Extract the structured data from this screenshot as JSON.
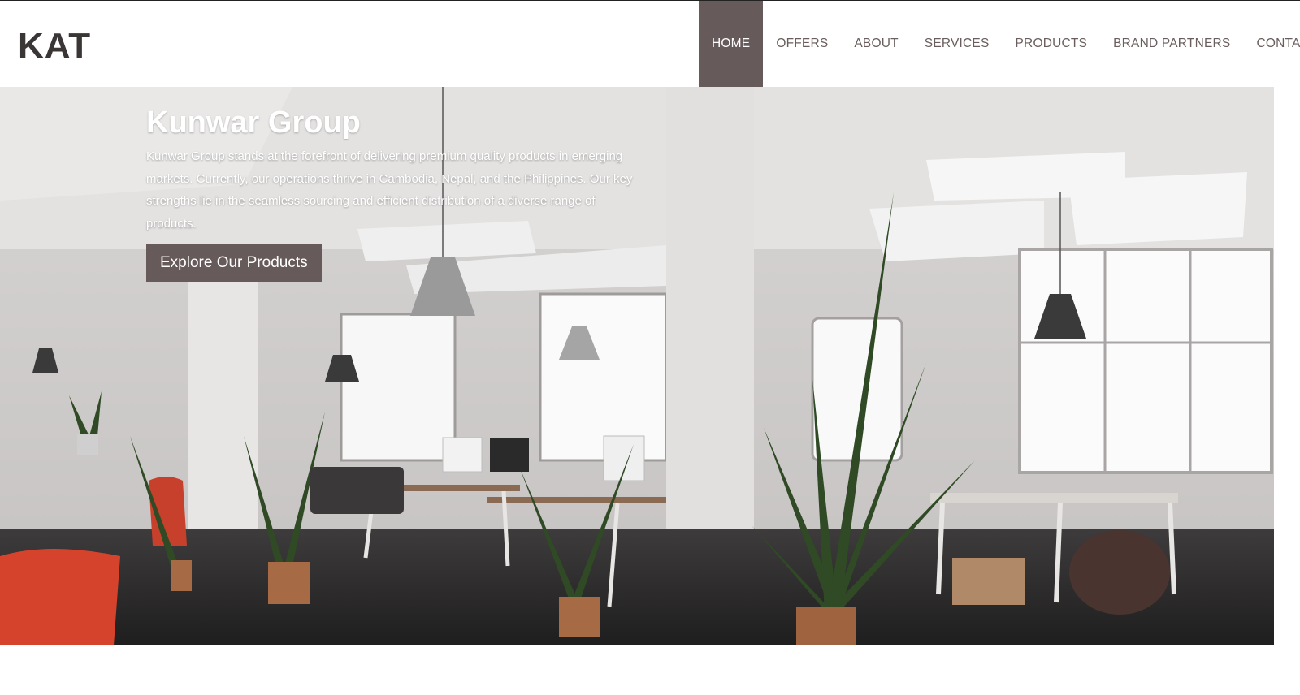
{
  "brand": {
    "logo": "KAT"
  },
  "nav": {
    "items": [
      {
        "label": "HOME",
        "active": true
      },
      {
        "label": "OFFERS",
        "active": false
      },
      {
        "label": "ABOUT",
        "active": false
      },
      {
        "label": "SERVICES",
        "active": false
      },
      {
        "label": "PRODUCTS",
        "active": false
      },
      {
        "label": "BRAND PARTNERS",
        "active": false
      },
      {
        "label": "CONTACT",
        "active": false
      }
    ]
  },
  "hero": {
    "title": "Kunwar Group",
    "description": "Kunwar Group stands at the forefront of delivering premium quality products in emerging markets. Currently, our operations thrive in Cambodia, Nepal, and the Philippines. Our key strengths lie in the seamless sourcing and efficient distribution of a diverse range of products.",
    "cta_label": "Explore Our Products",
    "background_image": "office-interior-photo"
  },
  "colors": {
    "accent": "#665a5a",
    "nav_text": "#6a5d5d",
    "logo_text": "#3a3636"
  }
}
